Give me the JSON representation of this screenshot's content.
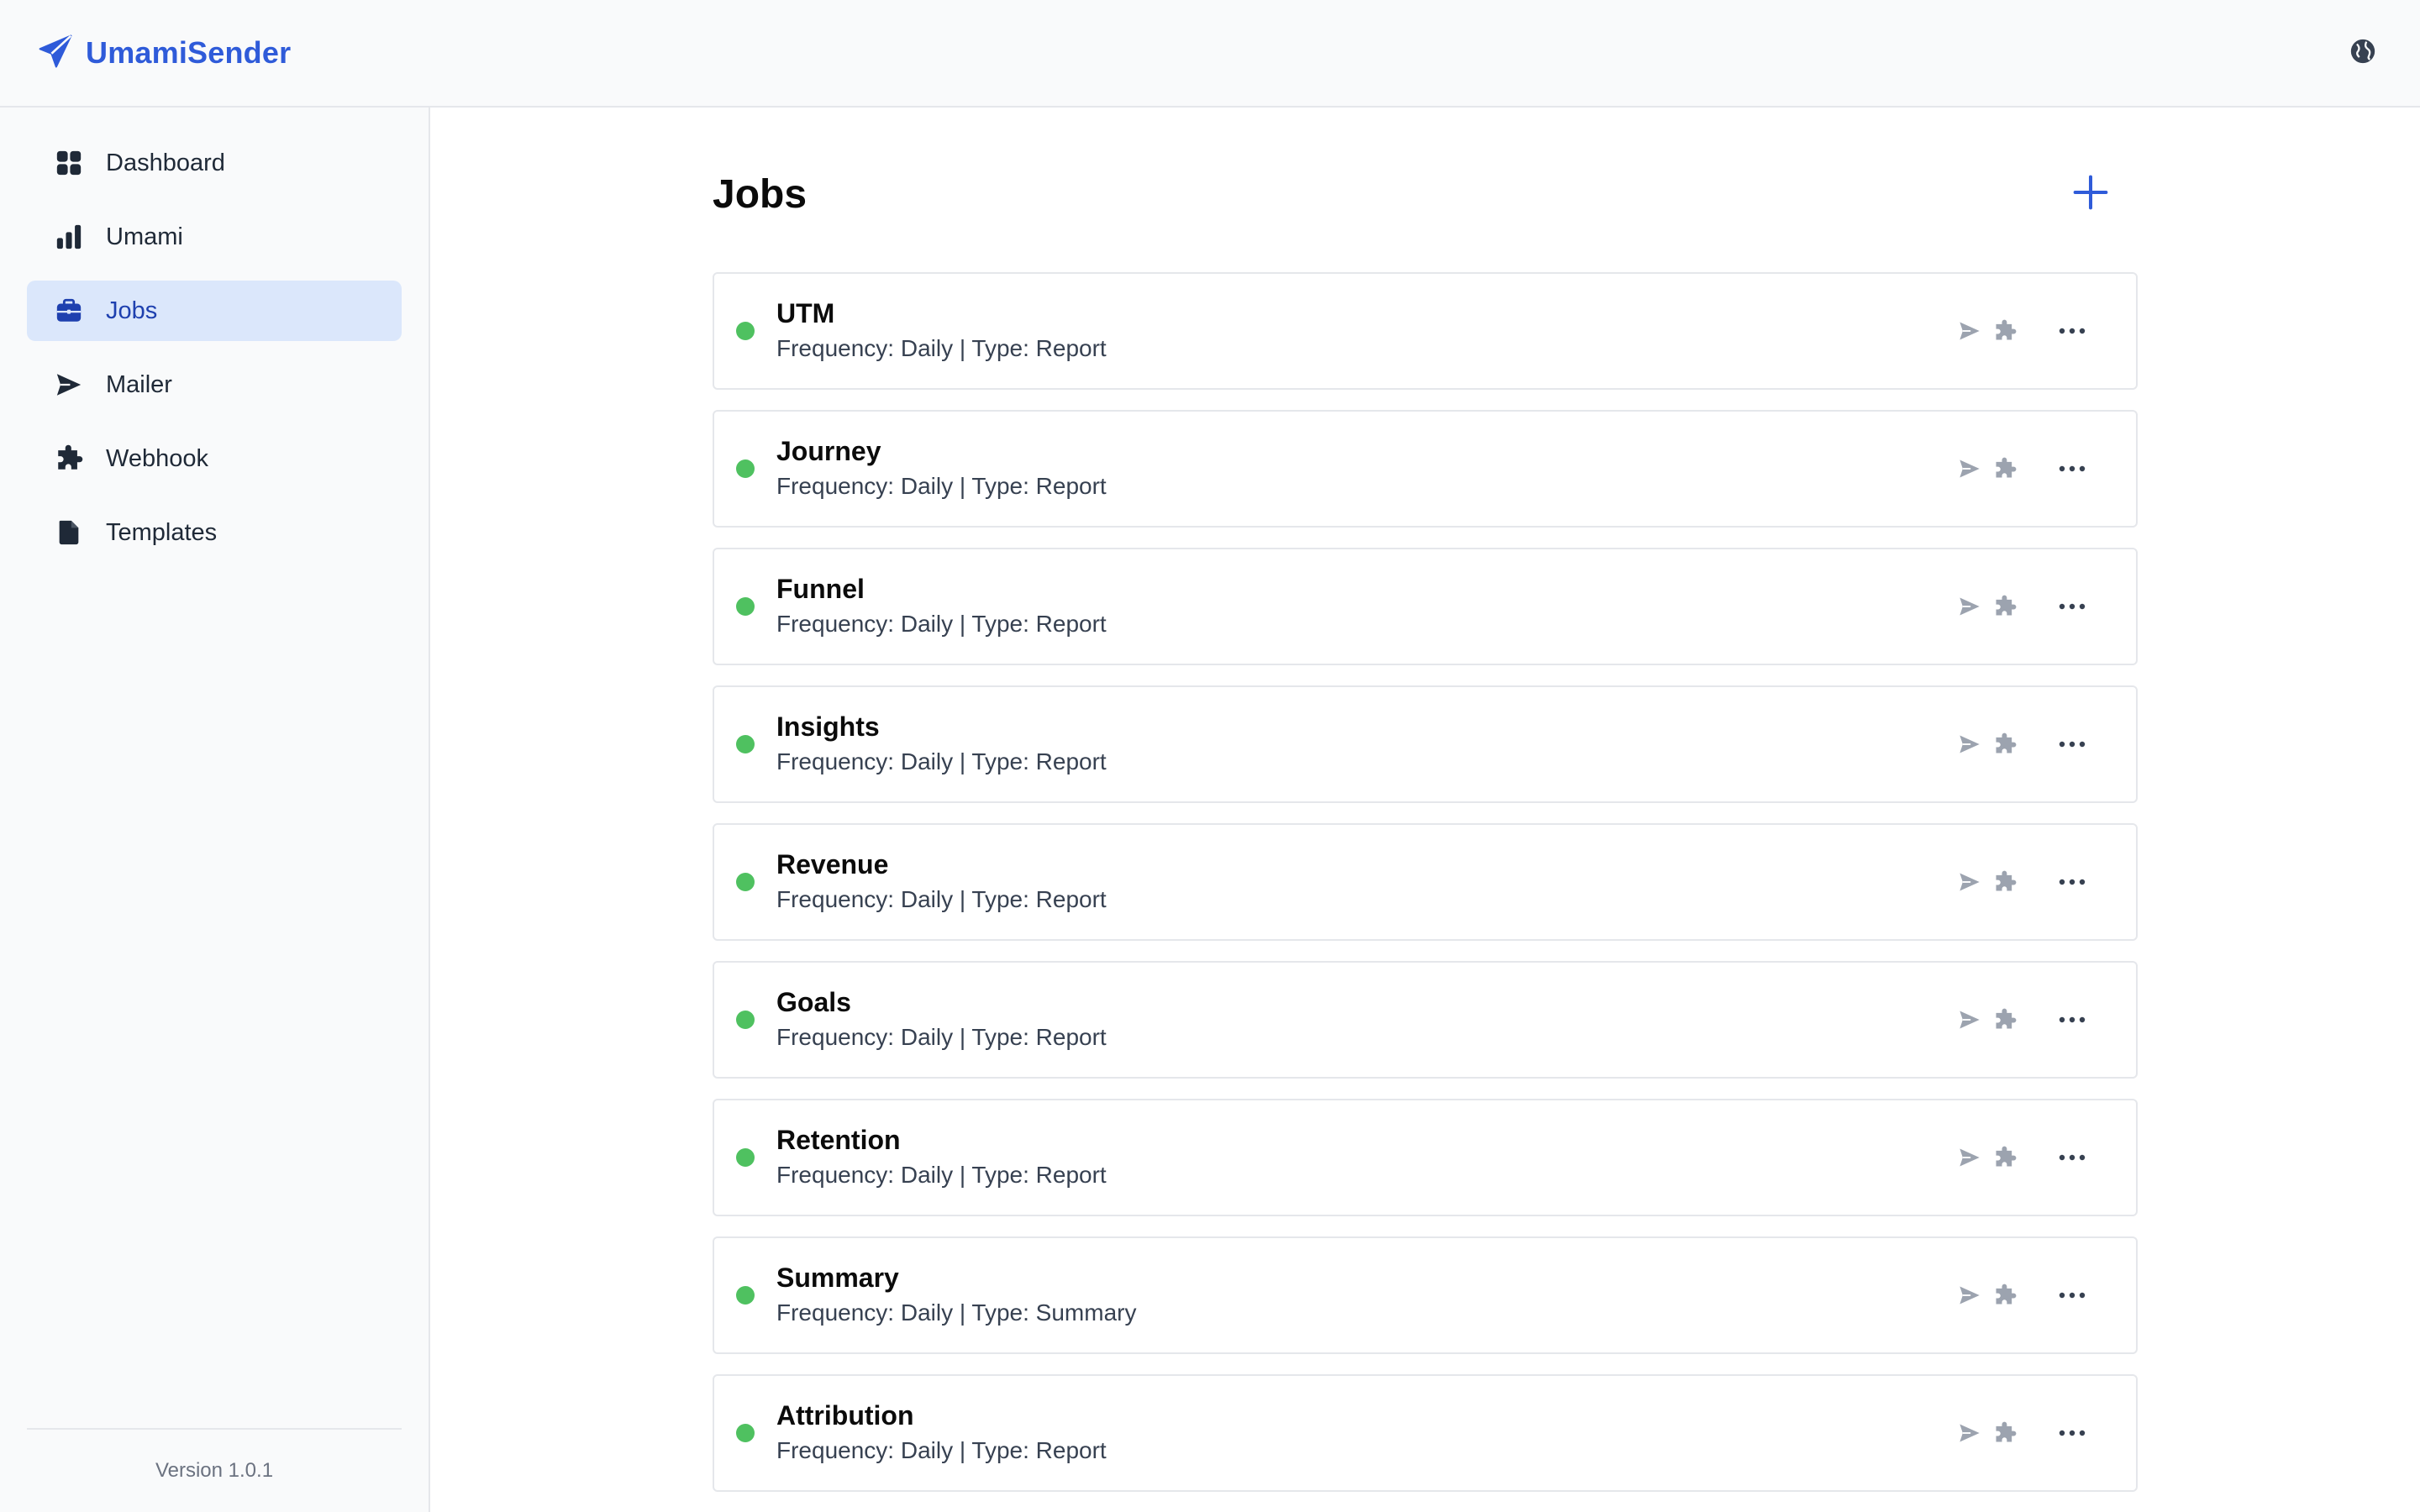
{
  "app": {
    "name": "UmamiSender",
    "logo_icon": "paper-plane-icon",
    "accent": "#2f5bd9"
  },
  "header": {
    "language_icon": "globe-icon"
  },
  "sidebar": {
    "items": [
      {
        "label": "Dashboard",
        "icon": "grid-icon",
        "active": false
      },
      {
        "label": "Umami",
        "icon": "bar-chart-icon",
        "active": false
      },
      {
        "label": "Jobs",
        "icon": "briefcase-icon",
        "active": true
      },
      {
        "label": "Mailer",
        "icon": "send-icon",
        "active": false
      },
      {
        "label": "Webhook",
        "icon": "puzzle-icon",
        "active": false
      },
      {
        "label": "Templates",
        "icon": "file-icon",
        "active": false
      }
    ],
    "version": "Version 1.0.1"
  },
  "main": {
    "title": "Jobs",
    "add_icon": "plus-icon",
    "status_color": "#4fc160",
    "jobs": [
      {
        "name": "UTM",
        "meta": "Frequency: Daily | Type: Report"
      },
      {
        "name": "Journey",
        "meta": "Frequency: Daily | Type: Report"
      },
      {
        "name": "Funnel",
        "meta": "Frequency: Daily | Type: Report"
      },
      {
        "name": "Insights",
        "meta": "Frequency: Daily | Type: Report"
      },
      {
        "name": "Revenue",
        "meta": "Frequency: Daily | Type: Report"
      },
      {
        "name": "Goals",
        "meta": "Frequency: Daily | Type: Report"
      },
      {
        "name": "Retention",
        "meta": "Frequency: Daily | Type: Report"
      },
      {
        "name": "Summary",
        "meta": "Frequency: Daily | Type: Summary"
      },
      {
        "name": "Attribution",
        "meta": "Frequency: Daily | Type: Report"
      }
    ]
  }
}
